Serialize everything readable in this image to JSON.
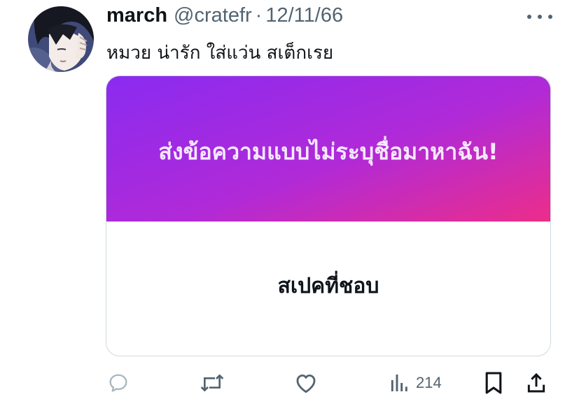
{
  "tweet": {
    "display_name": "march",
    "handle": "@cratefr",
    "separator": "·",
    "date": "12/11/66",
    "text": "หมวย น่ารัก ใส่แว่น สเต็กเรย"
  },
  "card": {
    "prompt": "ส่งข้อความแบบไม่ระบุชื่อมาหาฉัน!",
    "answer": "สเปคที่ชอบ",
    "gradient_colors": [
      "#8a2bf0",
      "#b02ad8",
      "#ec2d8a"
    ]
  },
  "actions": {
    "reply_icon": "reply-icon",
    "retweet_icon": "retweet-icon",
    "like_icon": "heart-icon",
    "views_icon": "views-icon",
    "views_count": "214",
    "bookmark_icon": "bookmark-icon",
    "share_icon": "share-icon"
  },
  "colors": {
    "text_primary": "#0f1419",
    "text_secondary": "#536471",
    "border": "#cfd9de"
  }
}
